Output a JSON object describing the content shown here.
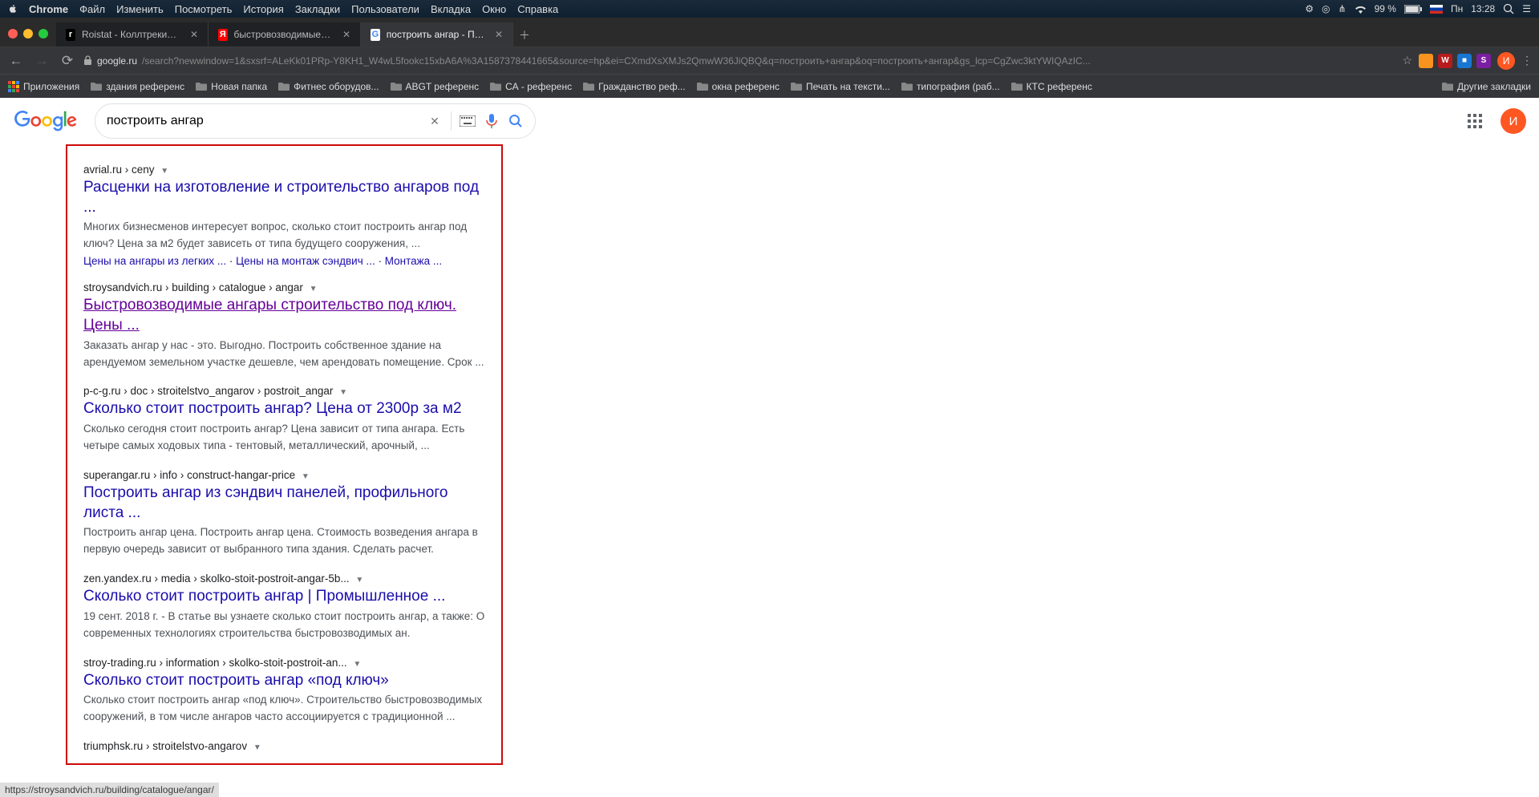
{
  "menubar": {
    "app": "Chrome",
    "items": [
      "Файл",
      "Изменить",
      "Посмотреть",
      "История",
      "Закладки",
      "Пользователи",
      "Вкладка",
      "Окно",
      "Справка"
    ],
    "battery": "99 %",
    "day": "Пн",
    "time": "13:28"
  },
  "tabs": [
    {
      "favtext": "r",
      "favbg": "#000",
      "favcolor": "#fff",
      "label": "Roistat - Коллтрекинг - Исто",
      "active": false
    },
    {
      "favtext": "Я",
      "favbg": "#ff0000",
      "favcolor": "#fff",
      "label": "быстровозводимые здания –",
      "active": false
    },
    {
      "favtext": "G",
      "favbg": "#fff",
      "favcolor": "#4285f4",
      "label": "построить ангар - Поиск в G",
      "active": true
    }
  ],
  "url": {
    "host": "google.ru",
    "path": "/search?newwindow=1&sxsrf=ALeKk01PRp-Y8KH1_W4wL5fookc15xbA6A%3A1587378441665&source=hp&ei=CXmdXsXMJs2QmwW36JiQBQ&q=построить+ангар&oq=построить+ангар&gs_lcp=CgZwc3ktYWIQAzIC..."
  },
  "extensions": [
    {
      "bg": "#f7931e",
      "t": ""
    },
    {
      "bg": "#b71c1c",
      "t": "W"
    },
    {
      "bg": "#1976d2",
      "t": "■"
    },
    {
      "bg": "#7b1fa2",
      "t": "S"
    }
  ],
  "bookmarks": {
    "apps": "Приложения",
    "items": [
      "здания референс",
      "Новая папка",
      "Фитнес оборудов...",
      "ABGT референс",
      "СА - референс",
      "Гражданство реф...",
      "окна референс",
      "Печать на тексти...",
      "типография (раб...",
      "КТС референс"
    ],
    "other": "Другие закладки"
  },
  "search": {
    "value": "построить ангар"
  },
  "results": [
    {
      "url": "avrial.ru › ceny",
      "title": "Расценки на изготовление и строительство ангаров под ...",
      "visited": false,
      "snippet": "Многих бизнесменов интересует вопрос, сколько стоит построить ангар под ключ? Цена за м2 будет зависеть от типа будущего сооружения, ...",
      "sublinks": [
        "Цены на ангары из легких ...",
        "Цены на монтаж сэндвич ...",
        "Монтажа ..."
      ]
    },
    {
      "url": "stroysandvich.ru › building › catalogue › angar",
      "title": "Быстровозводимые ангары строительство под ключ. Цены ...",
      "visited": true,
      "snippet": "Заказать ангар у нас - это. Выгодно. Построить собственное здание на арендуемом земельном участке дешевле, чем арендовать помещение. Срок ..."
    },
    {
      "url": "p-c-g.ru › doc › stroitelstvo_angarov › postroit_angar",
      "title": "Сколько стоит построить ангар? Цена от 2300р за м2",
      "visited": false,
      "snippet": "Сколько сегодня стоит построить ангар? Цена зависит от типа ангара. Есть четыре самых ходовых типа - тентовый, металлический, арочный, ..."
    },
    {
      "url": "superangar.ru › info › construct-hangar-price",
      "title": "Построить ангар из сэндвич панелей, профильного листа ...",
      "visited": false,
      "snippet": "Построить ангар цена. Построить ангар цена. Стоимость возведения ангара в первую очередь зависит от выбранного типа здания. Сделать расчет."
    },
    {
      "url": "zen.yandex.ru › media › skolko-stoit-postroit-angar-5b...",
      "title": "Сколько стоит построить ангар | Промышленное ...",
      "visited": false,
      "snippet": "19 сент. 2018 г. - В статье вы узнаете сколько стоит построить ангар, а также: О современных технологиях строительства быстровозводимых ан."
    },
    {
      "url": "stroy-trading.ru › information › skolko-stoit-postroit-an...",
      "title": "Сколько стоит построить ангар «под ключ»",
      "visited": false,
      "snippet": "Сколько стоит построить ангар «под ключ». Строительство быстровозводимых сооружений, в том числе ангаров часто ассоциируется с традиционной ..."
    },
    {
      "url": "triumphsk.ru › stroitelstvo-angarov",
      "title": "",
      "visited": false,
      "cut": true
    }
  ],
  "status": "https://stroysandvich.ru/building/catalogue/angar/",
  "avatar": "И"
}
